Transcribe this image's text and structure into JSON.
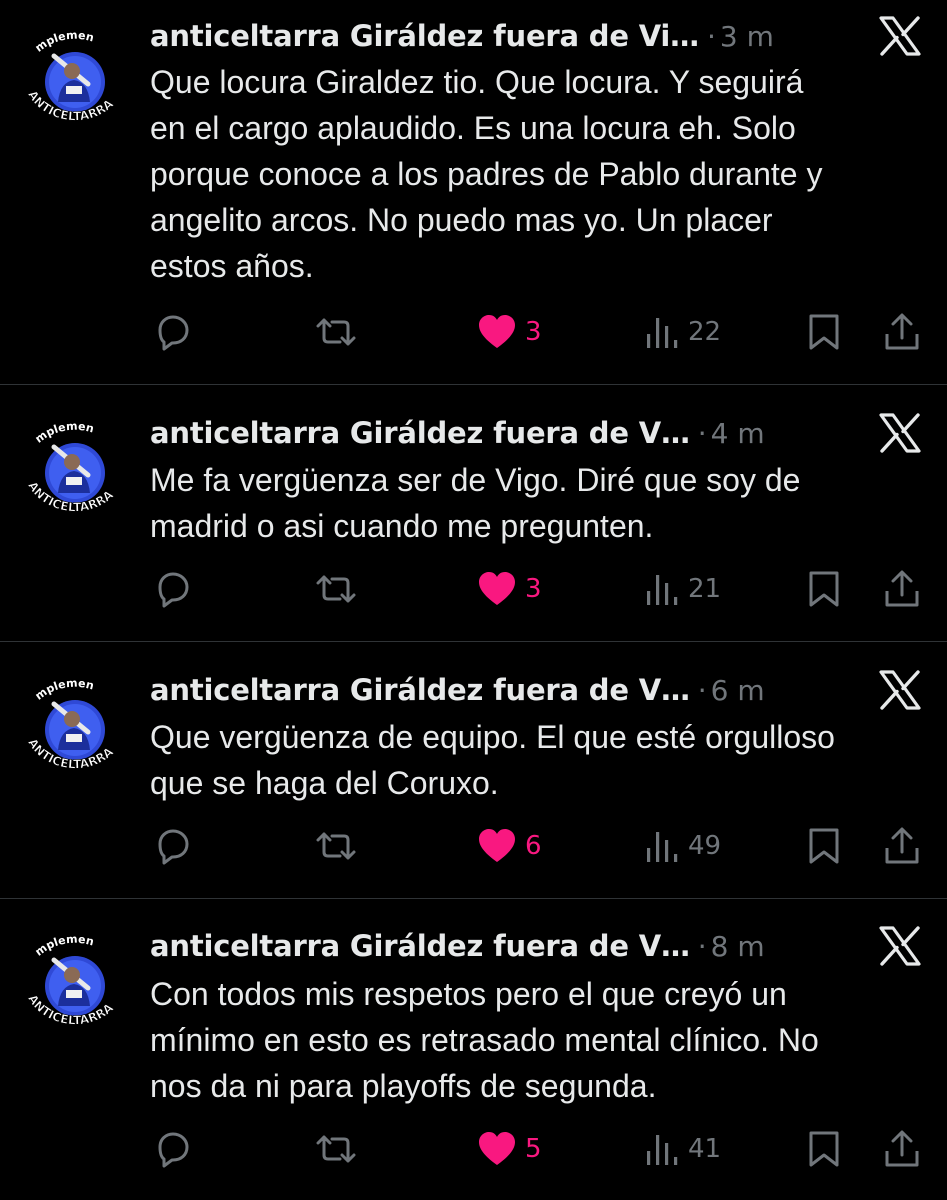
{
  "colors": {
    "background": "#000000",
    "text": "#e7e9ea",
    "muted": "#71767b",
    "like": "#f91880",
    "avatar_blue": "#2f49d6",
    "divider": "#2f3336"
  },
  "icons": {
    "reply": "reply-icon",
    "retweet": "retweet-icon",
    "like": "heart-icon",
    "views": "views-icon",
    "bookmark": "bookmark-icon",
    "share": "share-icon",
    "platform": "x-logo-icon"
  },
  "avatar": {
    "top_text": "mplemen",
    "bottom_text": "ANTICELTARRA"
  },
  "tweets": [
    {
      "name": "anticeltarra Giráldez fuera de Vi…",
      "dot": "·",
      "time": "3 m",
      "lines": [
        "Que locura Giraldez tio. Que locura. Y seguirá",
        "en el cargo aplaudido. Es una locura eh. Solo",
        "porque conoce a los padres de Pablo durante y",
        "angelito arcos. No puedo mas yo.  Un placer",
        "estos años."
      ],
      "likes": "3",
      "views": "22"
    },
    {
      "name": "anticeltarra Giráldez fuera de V…",
      "dot": "·",
      "time": "4 m",
      "lines": [
        "Me fa vergüenza ser de Vigo. Diré que soy de",
        "madrid o asi cuando me pregunten."
      ],
      "likes": "3",
      "views": "21"
    },
    {
      "name": "anticeltarra Giráldez fuera de V…",
      "dot": "·",
      "time": "6 m",
      "lines": [
        "Que vergüenza de equipo. El que esté orgulloso",
        "que se haga del Coruxo."
      ],
      "likes": "6",
      "views": "49"
    },
    {
      "name": "anticeltarra Giráldez fuera de V…",
      "dot": "·",
      "time": "8 m",
      "lines": [
        "Con todos mis respetos pero el que creyó un",
        "mínimo en esto es retrasado mental clínico. No",
        "nos da ni para playoffs de segunda."
      ],
      "likes": "5",
      "views": "41"
    }
  ]
}
